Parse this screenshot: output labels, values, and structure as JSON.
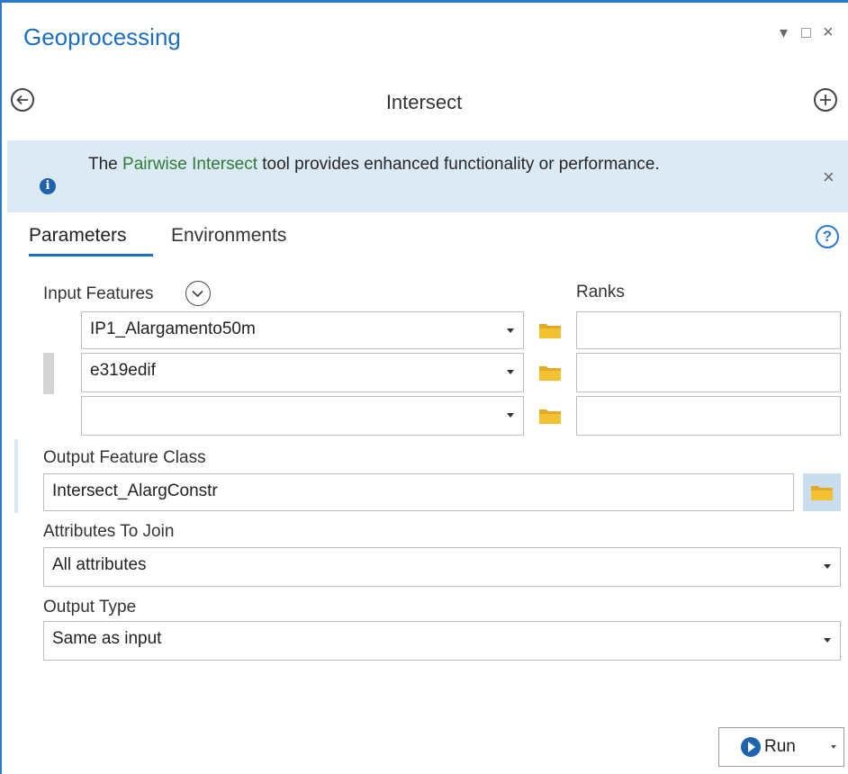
{
  "window": {
    "title": "Geoprocessing"
  },
  "header": {
    "tool_title": "Intersect"
  },
  "banner": {
    "text_before": "The ",
    "link": "Pairwise Intersect",
    "text_after": " tool provides enhanced functionality or performance."
  },
  "tabs": [
    {
      "label": "Parameters",
      "active": true
    },
    {
      "label": "Environments",
      "active": false
    }
  ],
  "input_features": {
    "label": "Input Features",
    "ranks_label": "Ranks",
    "rows": [
      {
        "value": "IP1_Alargamento50m",
        "rank": ""
      },
      {
        "value": "e319edif",
        "rank": ""
      },
      {
        "value": "",
        "rank": ""
      }
    ]
  },
  "output_feature_class": {
    "label": "Output Feature Class",
    "value": "Intersect_AlargConstr"
  },
  "attributes_to_join": {
    "label": "Attributes To Join",
    "value": "All attributes"
  },
  "output_type": {
    "label": "Output Type",
    "value": "Same as input"
  },
  "run_button": {
    "label": "Run"
  },
  "colors": {
    "accent": "#1b6ec2",
    "banner_bg": "#dceaf6",
    "link_green": "#2e7d32",
    "folder_yellow": "#f2c230"
  }
}
